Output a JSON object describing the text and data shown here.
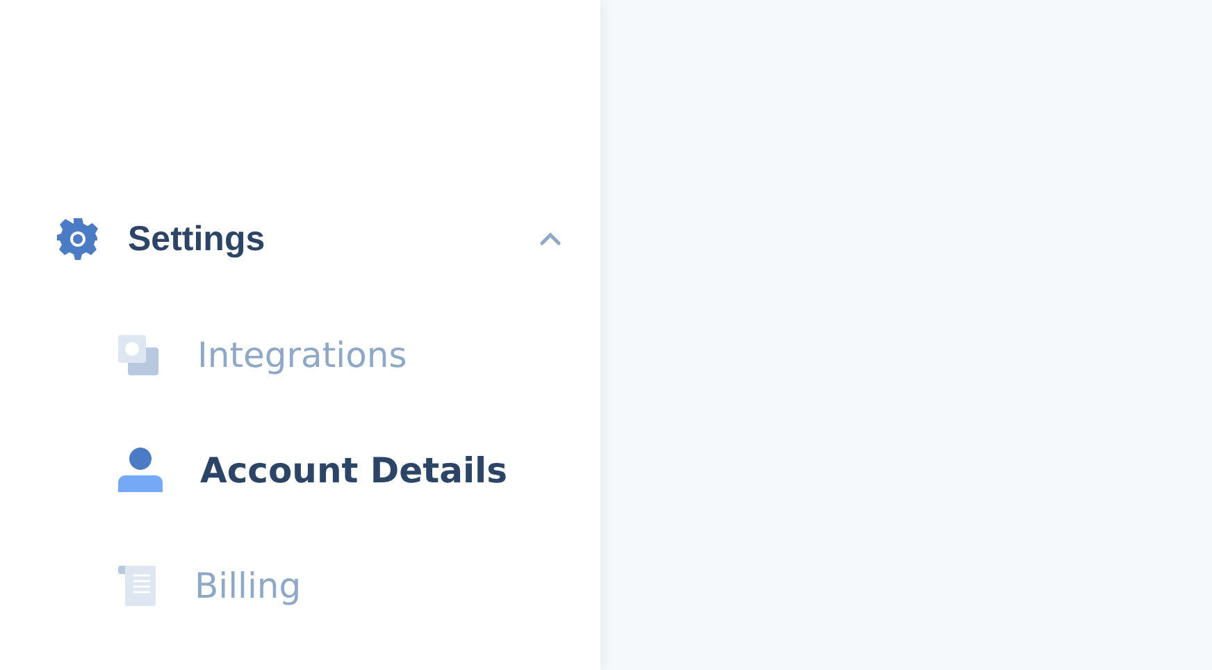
{
  "section": {
    "title": "Settings",
    "expanded": true,
    "items": [
      {
        "label": "Integrations",
        "kind": "integrations",
        "selected": false
      },
      {
        "label": "Account Details",
        "kind": "account",
        "selected": true
      },
      {
        "label": "Billing",
        "kind": "billing",
        "selected": false
      }
    ]
  }
}
